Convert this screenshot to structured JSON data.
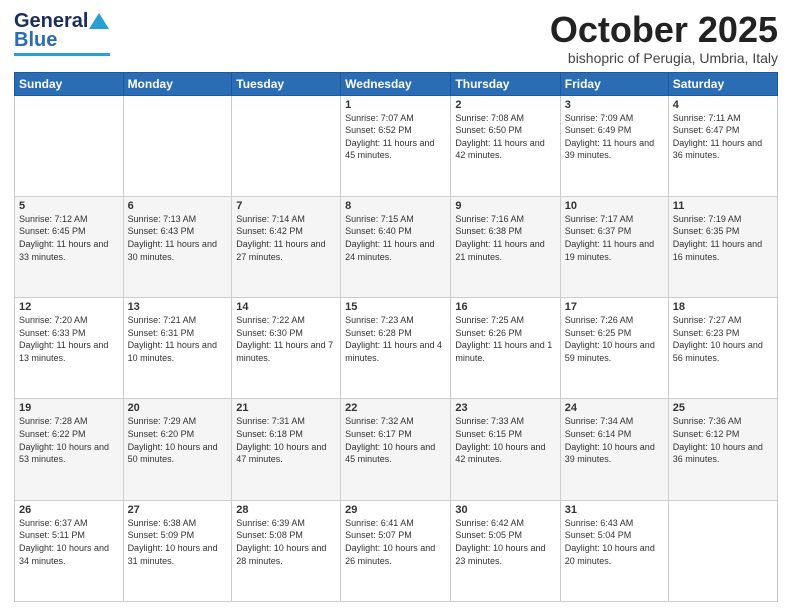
{
  "header": {
    "logo_general": "General",
    "logo_blue": "Blue",
    "month_title": "October 2025",
    "subtitle": "bishopric of Perugia, Umbria, Italy"
  },
  "days_of_week": [
    "Sunday",
    "Monday",
    "Tuesday",
    "Wednesday",
    "Thursday",
    "Friday",
    "Saturday"
  ],
  "weeks": [
    [
      {
        "day": "",
        "info": ""
      },
      {
        "day": "",
        "info": ""
      },
      {
        "day": "",
        "info": ""
      },
      {
        "day": "1",
        "info": "Sunrise: 7:07 AM\nSunset: 6:52 PM\nDaylight: 11 hours and 45 minutes."
      },
      {
        "day": "2",
        "info": "Sunrise: 7:08 AM\nSunset: 6:50 PM\nDaylight: 11 hours and 42 minutes."
      },
      {
        "day": "3",
        "info": "Sunrise: 7:09 AM\nSunset: 6:49 PM\nDaylight: 11 hours and 39 minutes."
      },
      {
        "day": "4",
        "info": "Sunrise: 7:11 AM\nSunset: 6:47 PM\nDaylight: 11 hours and 36 minutes."
      }
    ],
    [
      {
        "day": "5",
        "info": "Sunrise: 7:12 AM\nSunset: 6:45 PM\nDaylight: 11 hours and 33 minutes."
      },
      {
        "day": "6",
        "info": "Sunrise: 7:13 AM\nSunset: 6:43 PM\nDaylight: 11 hours and 30 minutes."
      },
      {
        "day": "7",
        "info": "Sunrise: 7:14 AM\nSunset: 6:42 PM\nDaylight: 11 hours and 27 minutes."
      },
      {
        "day": "8",
        "info": "Sunrise: 7:15 AM\nSunset: 6:40 PM\nDaylight: 11 hours and 24 minutes."
      },
      {
        "day": "9",
        "info": "Sunrise: 7:16 AM\nSunset: 6:38 PM\nDaylight: 11 hours and 21 minutes."
      },
      {
        "day": "10",
        "info": "Sunrise: 7:17 AM\nSunset: 6:37 PM\nDaylight: 11 hours and 19 minutes."
      },
      {
        "day": "11",
        "info": "Sunrise: 7:19 AM\nSunset: 6:35 PM\nDaylight: 11 hours and 16 minutes."
      }
    ],
    [
      {
        "day": "12",
        "info": "Sunrise: 7:20 AM\nSunset: 6:33 PM\nDaylight: 11 hours and 13 minutes."
      },
      {
        "day": "13",
        "info": "Sunrise: 7:21 AM\nSunset: 6:31 PM\nDaylight: 11 hours and 10 minutes."
      },
      {
        "day": "14",
        "info": "Sunrise: 7:22 AM\nSunset: 6:30 PM\nDaylight: 11 hours and 7 minutes."
      },
      {
        "day": "15",
        "info": "Sunrise: 7:23 AM\nSunset: 6:28 PM\nDaylight: 11 hours and 4 minutes."
      },
      {
        "day": "16",
        "info": "Sunrise: 7:25 AM\nSunset: 6:26 PM\nDaylight: 11 hours and 1 minute."
      },
      {
        "day": "17",
        "info": "Sunrise: 7:26 AM\nSunset: 6:25 PM\nDaylight: 10 hours and 59 minutes."
      },
      {
        "day": "18",
        "info": "Sunrise: 7:27 AM\nSunset: 6:23 PM\nDaylight: 10 hours and 56 minutes."
      }
    ],
    [
      {
        "day": "19",
        "info": "Sunrise: 7:28 AM\nSunset: 6:22 PM\nDaylight: 10 hours and 53 minutes."
      },
      {
        "day": "20",
        "info": "Sunrise: 7:29 AM\nSunset: 6:20 PM\nDaylight: 10 hours and 50 minutes."
      },
      {
        "day": "21",
        "info": "Sunrise: 7:31 AM\nSunset: 6:18 PM\nDaylight: 10 hours and 47 minutes."
      },
      {
        "day": "22",
        "info": "Sunrise: 7:32 AM\nSunset: 6:17 PM\nDaylight: 10 hours and 45 minutes."
      },
      {
        "day": "23",
        "info": "Sunrise: 7:33 AM\nSunset: 6:15 PM\nDaylight: 10 hours and 42 minutes."
      },
      {
        "day": "24",
        "info": "Sunrise: 7:34 AM\nSunset: 6:14 PM\nDaylight: 10 hours and 39 minutes."
      },
      {
        "day": "25",
        "info": "Sunrise: 7:36 AM\nSunset: 6:12 PM\nDaylight: 10 hours and 36 minutes."
      }
    ],
    [
      {
        "day": "26",
        "info": "Sunrise: 6:37 AM\nSunset: 5:11 PM\nDaylight: 10 hours and 34 minutes."
      },
      {
        "day": "27",
        "info": "Sunrise: 6:38 AM\nSunset: 5:09 PM\nDaylight: 10 hours and 31 minutes."
      },
      {
        "day": "28",
        "info": "Sunrise: 6:39 AM\nSunset: 5:08 PM\nDaylight: 10 hours and 28 minutes."
      },
      {
        "day": "29",
        "info": "Sunrise: 6:41 AM\nSunset: 5:07 PM\nDaylight: 10 hours and 26 minutes."
      },
      {
        "day": "30",
        "info": "Sunrise: 6:42 AM\nSunset: 5:05 PM\nDaylight: 10 hours and 23 minutes."
      },
      {
        "day": "31",
        "info": "Sunrise: 6:43 AM\nSunset: 5:04 PM\nDaylight: 10 hours and 20 minutes."
      },
      {
        "day": "",
        "info": ""
      }
    ]
  ]
}
